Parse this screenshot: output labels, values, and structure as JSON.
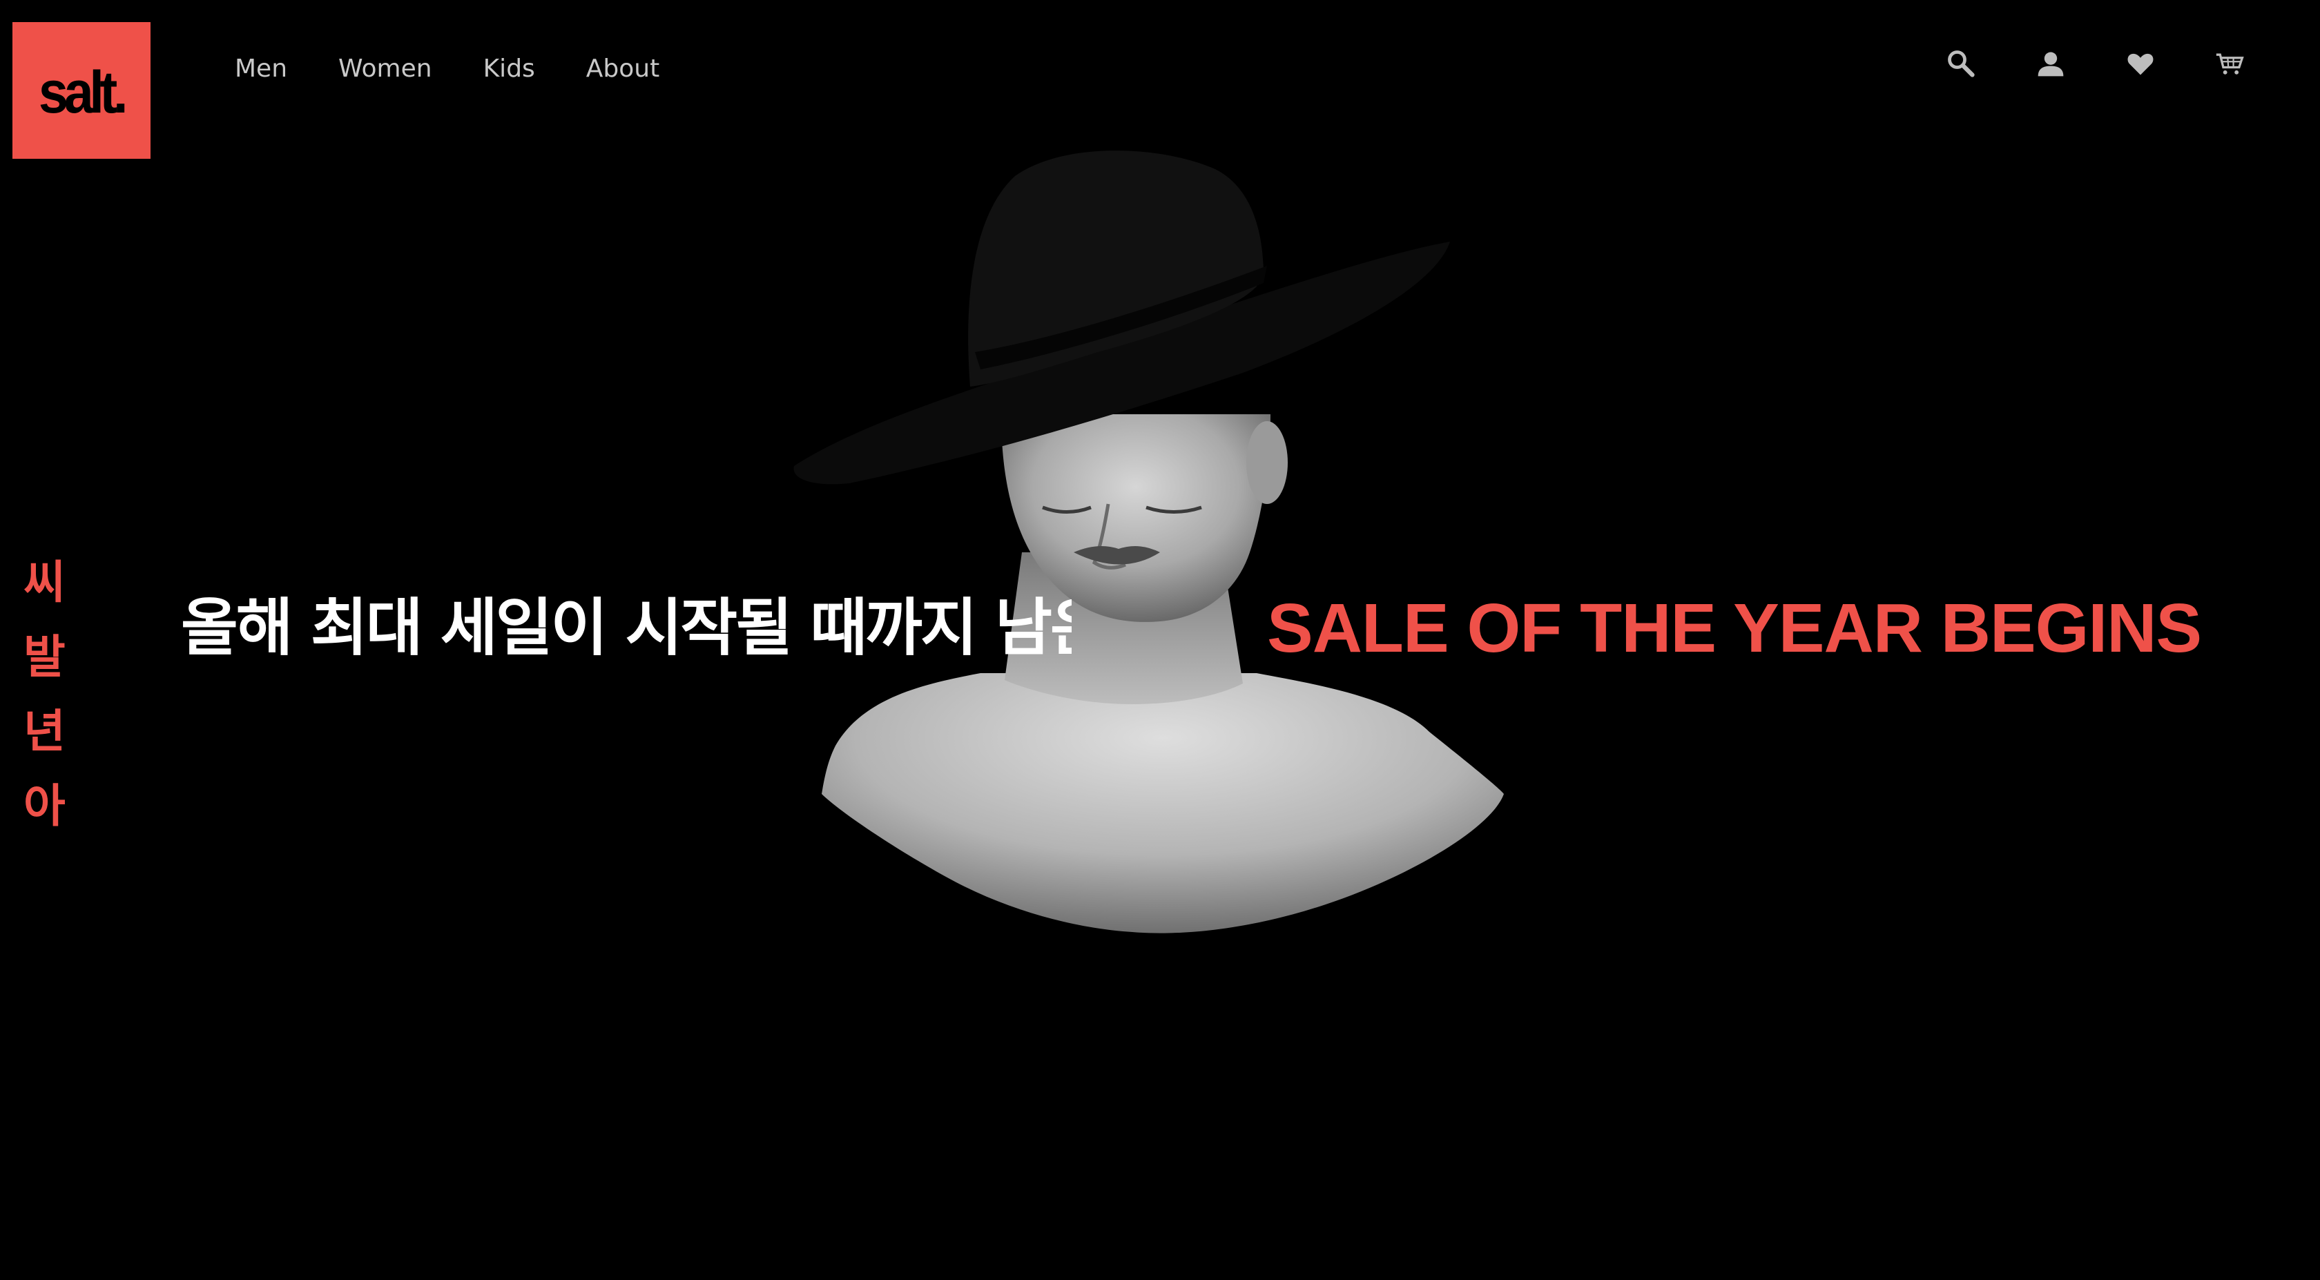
{
  "brand": {
    "logo_text": "salt.",
    "accent_color": "#ef5149",
    "background_color": "#000000"
  },
  "nav": {
    "items": [
      {
        "label": "Men"
      },
      {
        "label": "Women"
      },
      {
        "label": "Kids"
      },
      {
        "label": "About"
      }
    ]
  },
  "header_icons": [
    "search-icon",
    "user-icon",
    "heart-icon",
    "cart-icon"
  ],
  "hero": {
    "vertical_text": "씨발년아",
    "headline_korean": "올해 최대 세일이 시작될 때까지 남은",
    "headline_english": "SALE OF THE YEAR BEGINS",
    "image": "woman-in-black-hat-photo"
  }
}
